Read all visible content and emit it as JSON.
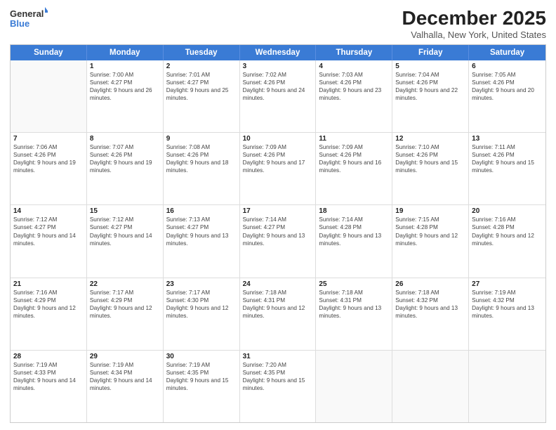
{
  "logo": {
    "line1": "General",
    "line2": "Blue"
  },
  "title": "December 2025",
  "subtitle": "Valhalla, New York, United States",
  "header_days": [
    "Sunday",
    "Monday",
    "Tuesday",
    "Wednesday",
    "Thursday",
    "Friday",
    "Saturday"
  ],
  "rows": [
    [
      {
        "num": "",
        "sunrise": "",
        "sunset": "",
        "daylight": ""
      },
      {
        "num": "1",
        "sunrise": "Sunrise: 7:00 AM",
        "sunset": "Sunset: 4:27 PM",
        "daylight": "Daylight: 9 hours and 26 minutes."
      },
      {
        "num": "2",
        "sunrise": "Sunrise: 7:01 AM",
        "sunset": "Sunset: 4:27 PM",
        "daylight": "Daylight: 9 hours and 25 minutes."
      },
      {
        "num": "3",
        "sunrise": "Sunrise: 7:02 AM",
        "sunset": "Sunset: 4:26 PM",
        "daylight": "Daylight: 9 hours and 24 minutes."
      },
      {
        "num": "4",
        "sunrise": "Sunrise: 7:03 AM",
        "sunset": "Sunset: 4:26 PM",
        "daylight": "Daylight: 9 hours and 23 minutes."
      },
      {
        "num": "5",
        "sunrise": "Sunrise: 7:04 AM",
        "sunset": "Sunset: 4:26 PM",
        "daylight": "Daylight: 9 hours and 22 minutes."
      },
      {
        "num": "6",
        "sunrise": "Sunrise: 7:05 AM",
        "sunset": "Sunset: 4:26 PM",
        "daylight": "Daylight: 9 hours and 20 minutes."
      }
    ],
    [
      {
        "num": "7",
        "sunrise": "Sunrise: 7:06 AM",
        "sunset": "Sunset: 4:26 PM",
        "daylight": "Daylight: 9 hours and 19 minutes."
      },
      {
        "num": "8",
        "sunrise": "Sunrise: 7:07 AM",
        "sunset": "Sunset: 4:26 PM",
        "daylight": "Daylight: 9 hours and 19 minutes."
      },
      {
        "num": "9",
        "sunrise": "Sunrise: 7:08 AM",
        "sunset": "Sunset: 4:26 PM",
        "daylight": "Daylight: 9 hours and 18 minutes."
      },
      {
        "num": "10",
        "sunrise": "Sunrise: 7:09 AM",
        "sunset": "Sunset: 4:26 PM",
        "daylight": "Daylight: 9 hours and 17 minutes."
      },
      {
        "num": "11",
        "sunrise": "Sunrise: 7:09 AM",
        "sunset": "Sunset: 4:26 PM",
        "daylight": "Daylight: 9 hours and 16 minutes."
      },
      {
        "num": "12",
        "sunrise": "Sunrise: 7:10 AM",
        "sunset": "Sunset: 4:26 PM",
        "daylight": "Daylight: 9 hours and 15 minutes."
      },
      {
        "num": "13",
        "sunrise": "Sunrise: 7:11 AM",
        "sunset": "Sunset: 4:26 PM",
        "daylight": "Daylight: 9 hours and 15 minutes."
      }
    ],
    [
      {
        "num": "14",
        "sunrise": "Sunrise: 7:12 AM",
        "sunset": "Sunset: 4:27 PM",
        "daylight": "Daylight: 9 hours and 14 minutes."
      },
      {
        "num": "15",
        "sunrise": "Sunrise: 7:12 AM",
        "sunset": "Sunset: 4:27 PM",
        "daylight": "Daylight: 9 hours and 14 minutes."
      },
      {
        "num": "16",
        "sunrise": "Sunrise: 7:13 AM",
        "sunset": "Sunset: 4:27 PM",
        "daylight": "Daylight: 9 hours and 13 minutes."
      },
      {
        "num": "17",
        "sunrise": "Sunrise: 7:14 AM",
        "sunset": "Sunset: 4:27 PM",
        "daylight": "Daylight: 9 hours and 13 minutes."
      },
      {
        "num": "18",
        "sunrise": "Sunrise: 7:14 AM",
        "sunset": "Sunset: 4:28 PM",
        "daylight": "Daylight: 9 hours and 13 minutes."
      },
      {
        "num": "19",
        "sunrise": "Sunrise: 7:15 AM",
        "sunset": "Sunset: 4:28 PM",
        "daylight": "Daylight: 9 hours and 12 minutes."
      },
      {
        "num": "20",
        "sunrise": "Sunrise: 7:16 AM",
        "sunset": "Sunset: 4:28 PM",
        "daylight": "Daylight: 9 hours and 12 minutes."
      }
    ],
    [
      {
        "num": "21",
        "sunrise": "Sunrise: 7:16 AM",
        "sunset": "Sunset: 4:29 PM",
        "daylight": "Daylight: 9 hours and 12 minutes."
      },
      {
        "num": "22",
        "sunrise": "Sunrise: 7:17 AM",
        "sunset": "Sunset: 4:29 PM",
        "daylight": "Daylight: 9 hours and 12 minutes."
      },
      {
        "num": "23",
        "sunrise": "Sunrise: 7:17 AM",
        "sunset": "Sunset: 4:30 PM",
        "daylight": "Daylight: 9 hours and 12 minutes."
      },
      {
        "num": "24",
        "sunrise": "Sunrise: 7:18 AM",
        "sunset": "Sunset: 4:31 PM",
        "daylight": "Daylight: 9 hours and 12 minutes."
      },
      {
        "num": "25",
        "sunrise": "Sunrise: 7:18 AM",
        "sunset": "Sunset: 4:31 PM",
        "daylight": "Daylight: 9 hours and 13 minutes."
      },
      {
        "num": "26",
        "sunrise": "Sunrise: 7:18 AM",
        "sunset": "Sunset: 4:32 PM",
        "daylight": "Daylight: 9 hours and 13 minutes."
      },
      {
        "num": "27",
        "sunrise": "Sunrise: 7:19 AM",
        "sunset": "Sunset: 4:32 PM",
        "daylight": "Daylight: 9 hours and 13 minutes."
      }
    ],
    [
      {
        "num": "28",
        "sunrise": "Sunrise: 7:19 AM",
        "sunset": "Sunset: 4:33 PM",
        "daylight": "Daylight: 9 hours and 14 minutes."
      },
      {
        "num": "29",
        "sunrise": "Sunrise: 7:19 AM",
        "sunset": "Sunset: 4:34 PM",
        "daylight": "Daylight: 9 hours and 14 minutes."
      },
      {
        "num": "30",
        "sunrise": "Sunrise: 7:19 AM",
        "sunset": "Sunset: 4:35 PM",
        "daylight": "Daylight: 9 hours and 15 minutes."
      },
      {
        "num": "31",
        "sunrise": "Sunrise: 7:20 AM",
        "sunset": "Sunset: 4:35 PM",
        "daylight": "Daylight: 9 hours and 15 minutes."
      },
      {
        "num": "",
        "sunrise": "",
        "sunset": "",
        "daylight": ""
      },
      {
        "num": "",
        "sunrise": "",
        "sunset": "",
        "daylight": ""
      },
      {
        "num": "",
        "sunrise": "",
        "sunset": "",
        "daylight": ""
      }
    ]
  ]
}
